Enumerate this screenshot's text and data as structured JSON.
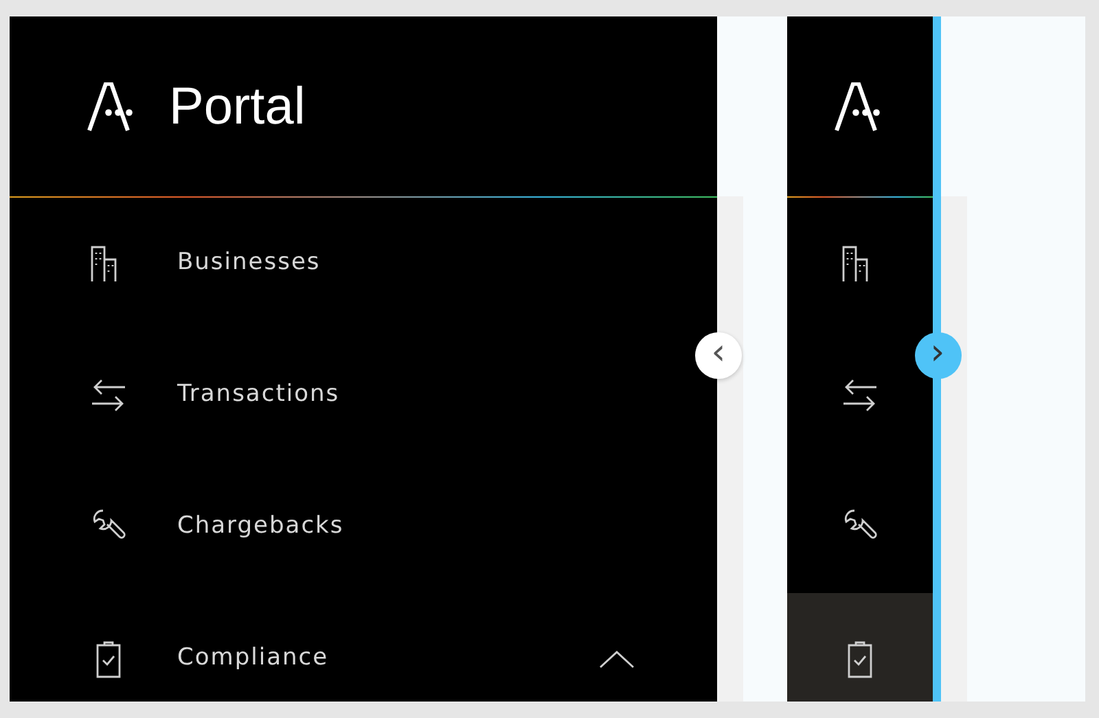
{
  "panels": [
    {
      "kind": "expanded",
      "logo": {
        "text": "Portal"
      },
      "toggle": {
        "glyph": "‹"
      },
      "items": [
        {
          "label": "Businesses",
          "selected": false
        },
        {
          "label": "Transactions",
          "selected": false
        },
        {
          "label": "Chargebacks",
          "selected": false
        },
        {
          "label": "Compliance",
          "selected": false,
          "expanded": true
        }
      ]
    },
    {
      "kind": "collapsed",
      "toggle": {
        "glyph": "›"
      },
      "items": [
        {
          "selected": false
        },
        {
          "selected": false
        },
        {
          "selected": false
        },
        {
          "selected": true
        }
      ]
    }
  ]
}
